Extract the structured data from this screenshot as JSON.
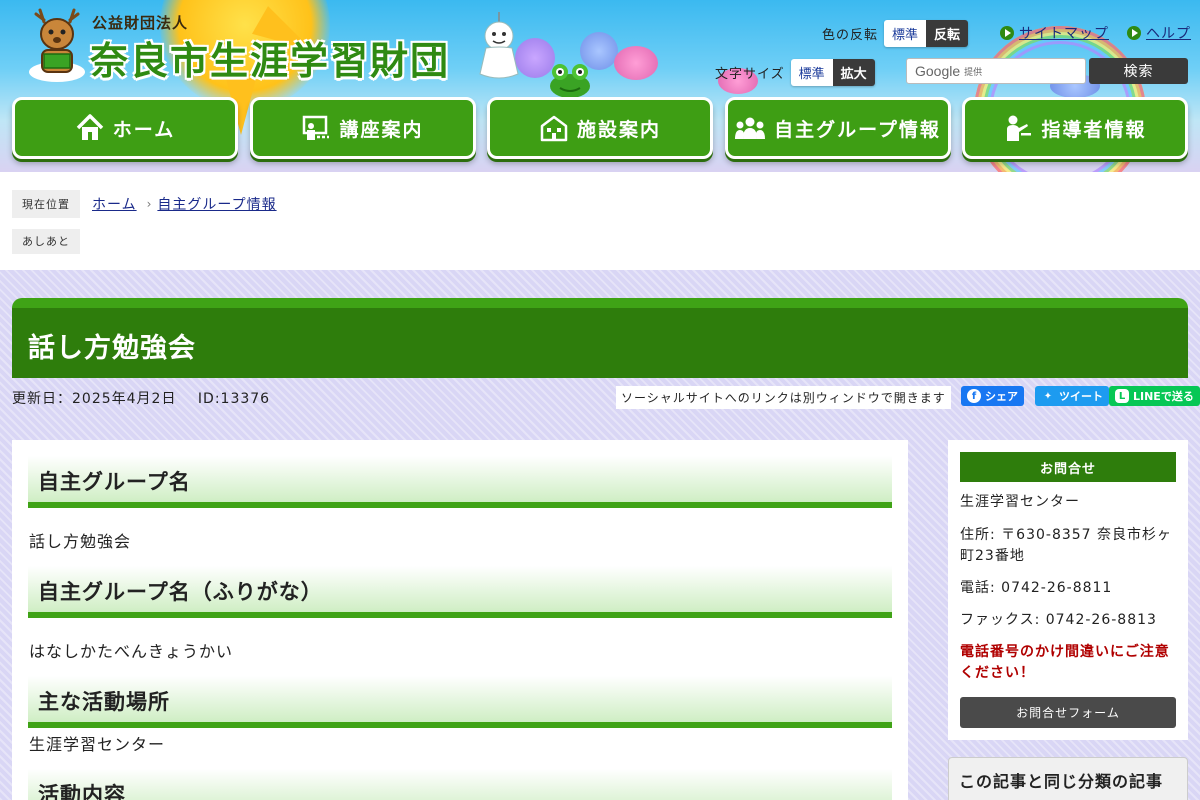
{
  "header": {
    "org_type": "公益財団法人",
    "org_name": "奈良市生涯学習財団",
    "color_invert": {
      "label": "色の反転",
      "normal": "標準",
      "inverted": "反転"
    },
    "text_size": {
      "label": "文字サイズ",
      "normal": "標準",
      "large": "拡大"
    },
    "links": {
      "sitemap": "サイトマップ",
      "help": "ヘルプ"
    },
    "search": {
      "provider_logo": "Google",
      "provider_suffix": "提供",
      "button": "検索"
    }
  },
  "nav": [
    {
      "label": "ホーム",
      "icon": "home-icon"
    },
    {
      "label": "講座案内",
      "icon": "lecture-icon"
    },
    {
      "label": "施設案内",
      "icon": "facility-icon"
    },
    {
      "label": "自主グループ情報",
      "icon": "group-icon"
    },
    {
      "label": "指導者情報",
      "icon": "instructor-icon"
    }
  ],
  "breadcrumb": {
    "current_label": "現在位置",
    "items": [
      "ホーム",
      "自主グループ情報"
    ],
    "footprint_label": "あしあと"
  },
  "page": {
    "title": "話し方勉強会",
    "updated": "更新日：2025年4月2日",
    "id": "ID:13376",
    "social_note": "ソーシャルサイトへのリンクは別ウィンドウで開きます",
    "share": {
      "facebook": "シェア",
      "twitter": "ツイート",
      "line": "LINEで送る"
    }
  },
  "sections": [
    {
      "heading": "自主グループ名",
      "text": "話し方勉強会"
    },
    {
      "heading": "自主グループ名（ふりがな）",
      "text": "はなしかたべんきょうかい"
    },
    {
      "heading": "主な活動場所",
      "text": "生涯学習センター"
    },
    {
      "heading": "活動内容",
      "text": ""
    }
  ],
  "contact": {
    "heading": "お問合せ",
    "name": "生涯学習センター",
    "address": "住所: 〒630-8357 奈良市杉ヶ町23番地",
    "phone": "電話: 0742-26-8811",
    "fax": "ファックス: 0742-26-8813",
    "warning": "電話番号のかけ間違いにご注意ください！",
    "form_button": "お問合せフォーム"
  },
  "related": {
    "heading": "この記事と同じ分類の記事"
  },
  "colors": {
    "green_dark": "#2e7d0c",
    "green": "#3fa316",
    "link": "#1a2a8a",
    "warning": "#b00000"
  }
}
